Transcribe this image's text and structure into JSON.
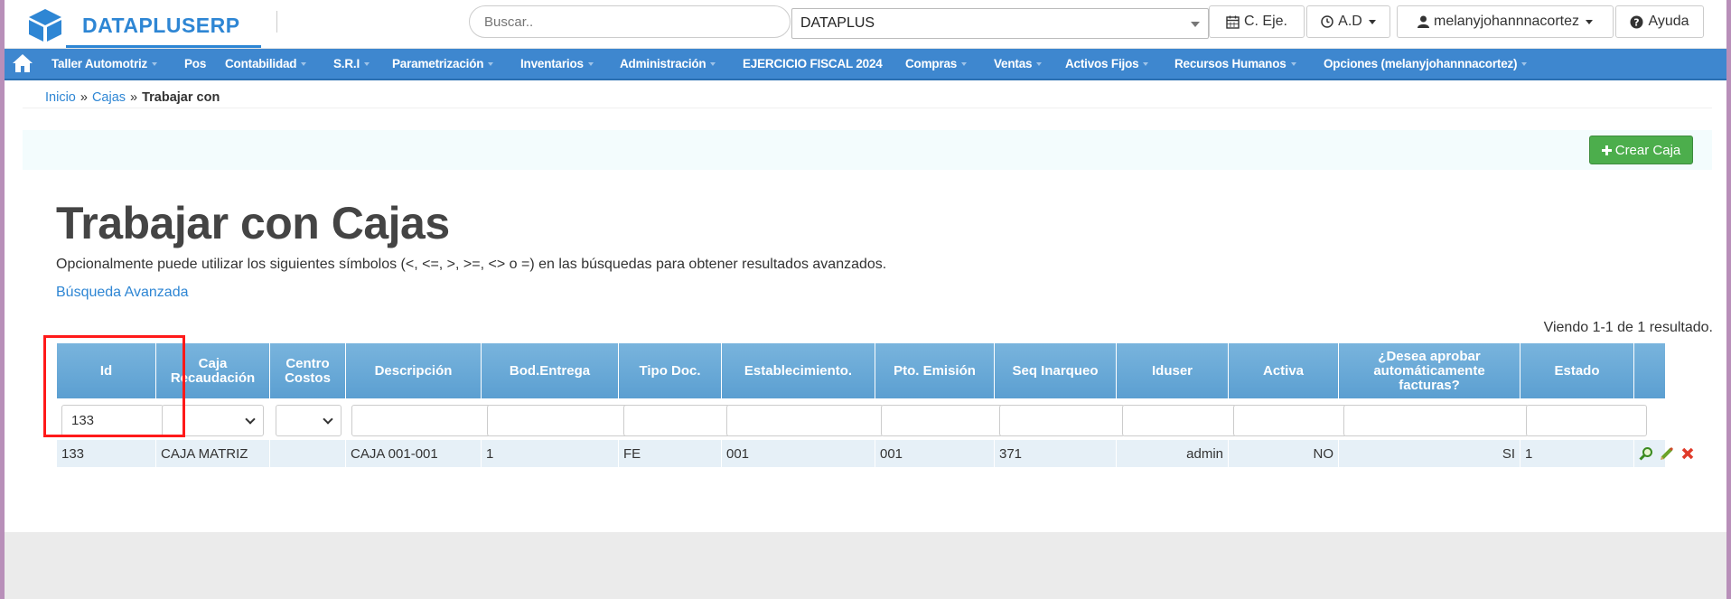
{
  "brand": {
    "name": "DATAPLUSERP"
  },
  "topbar": {
    "search_placeholder": "Buscar..",
    "company": "DATAPLUS",
    "fiscal_btn": "C. Eje.",
    "ad_btn": "A.D",
    "user_btn": "melanyjohannnacortez",
    "help_btn": "Ayuda"
  },
  "nav": {
    "items": [
      "Taller Automotriz",
      "Pos",
      "Contabilidad",
      "S.R.I",
      "Parametrización",
      "Inventarios",
      "Administración",
      "EJERCICIO FISCAL 2024",
      "Compras",
      "Ventas",
      "Activos Fijos",
      "Recursos Humanos",
      "Opciones (melanyjohannnacortez)"
    ]
  },
  "breadcrumb": {
    "home": "Inicio",
    "section": "Cajas",
    "current": "Trabajar con"
  },
  "actions": {
    "create": "Crear Caja"
  },
  "page": {
    "title": "Trabajar con Cajas",
    "hint": "Opcionalmente puede utilizar los siguientes símbolos (<, <=, >, >=, <> o =) en las búsquedas para obtener resultados avanzados.",
    "advanced": "Búsqueda Avanzada",
    "summary": "Viendo 1-1 de 1 resultado."
  },
  "grid": {
    "headers": [
      "Id",
      "Caja Recaudación",
      "Centro Costos",
      "Descripción",
      "Bod.Entrega",
      "Tipo Doc.",
      "Establecimiento.",
      "Pto. Emisión",
      "Seq Inarqueo",
      "Iduser",
      "Activa",
      "¿Desea aprobar automáticamente facturas?",
      "Estado"
    ],
    "filter_id": "133",
    "rows": [
      [
        "133",
        "CAJA MATRIZ",
        "",
        "CAJA 001-001",
        "1",
        "FE",
        "001",
        "001",
        "371",
        "admin",
        "NO",
        "SI",
        "1"
      ]
    ]
  },
  "colors": {
    "accent": "#2e86d4",
    "nav": "#3e87cf",
    "success": "#4cae4c",
    "highlight": "#ff1a1a"
  }
}
